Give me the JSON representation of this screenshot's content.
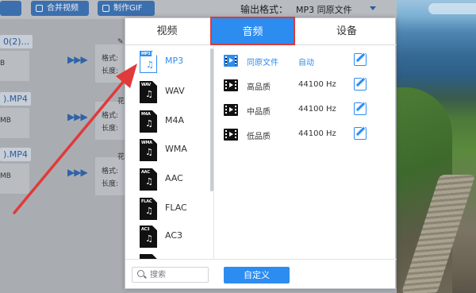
{
  "toolbar": {
    "buttons": [
      {
        "label": "",
        "icon": "folder-icon"
      },
      {
        "label": "合并视频",
        "icon": "merge-icon"
      },
      {
        "label": "制作GIF",
        "icon": "gif-icon"
      }
    ],
    "output_format_label": "输出格式：",
    "output_format_value": "MP3  同原文件"
  },
  "files": [
    {
      "name": "0(2)...",
      "size": "B",
      "format_label": "格式:",
      "length_label": "长度:",
      "option": ""
    },
    {
      "name": ").MP4",
      "size": "MB",
      "format_label": "格式:",
      "length_label": "长度:",
      "option": "花"
    },
    {
      "name": ").MP4",
      "size": "MB",
      "format_label": "格式:",
      "length_label": "长度:",
      "option": "花"
    }
  ],
  "dialog": {
    "tabs": [
      {
        "label": "视频",
        "active": false
      },
      {
        "label": "音频",
        "active": true
      },
      {
        "label": "设备",
        "active": false
      }
    ],
    "formats": [
      {
        "tag": "MP3",
        "label": "MP3",
        "selected": true
      },
      {
        "tag": "WAV",
        "label": "WAV",
        "selected": false
      },
      {
        "tag": "M4A",
        "label": "M4A",
        "selected": false
      },
      {
        "tag": "WMA",
        "label": "WMA",
        "selected": false
      },
      {
        "tag": "AAC",
        "label": "AAC",
        "selected": false
      },
      {
        "tag": "FLAC",
        "label": "FLAC",
        "selected": false
      },
      {
        "tag": "AC3",
        "label": "AC3",
        "selected": false
      },
      {
        "tag": "",
        "label": "",
        "selected": false
      }
    ],
    "qualities": [
      {
        "name": "同原文件",
        "rate": "自动",
        "selected": true
      },
      {
        "name": "高品质",
        "rate": "44100 Hz",
        "selected": false
      },
      {
        "name": "中品质",
        "rate": "44100 Hz",
        "selected": false
      },
      {
        "name": "低品质",
        "rate": "44100 Hz",
        "selected": false
      }
    ],
    "search_placeholder": "搜索",
    "custom_button_label": "自定义"
  },
  "colors": {
    "accent": "#2d8cf0",
    "highlight_border": "#dc3b3b",
    "annotation_arrow": "#e03a3a"
  }
}
